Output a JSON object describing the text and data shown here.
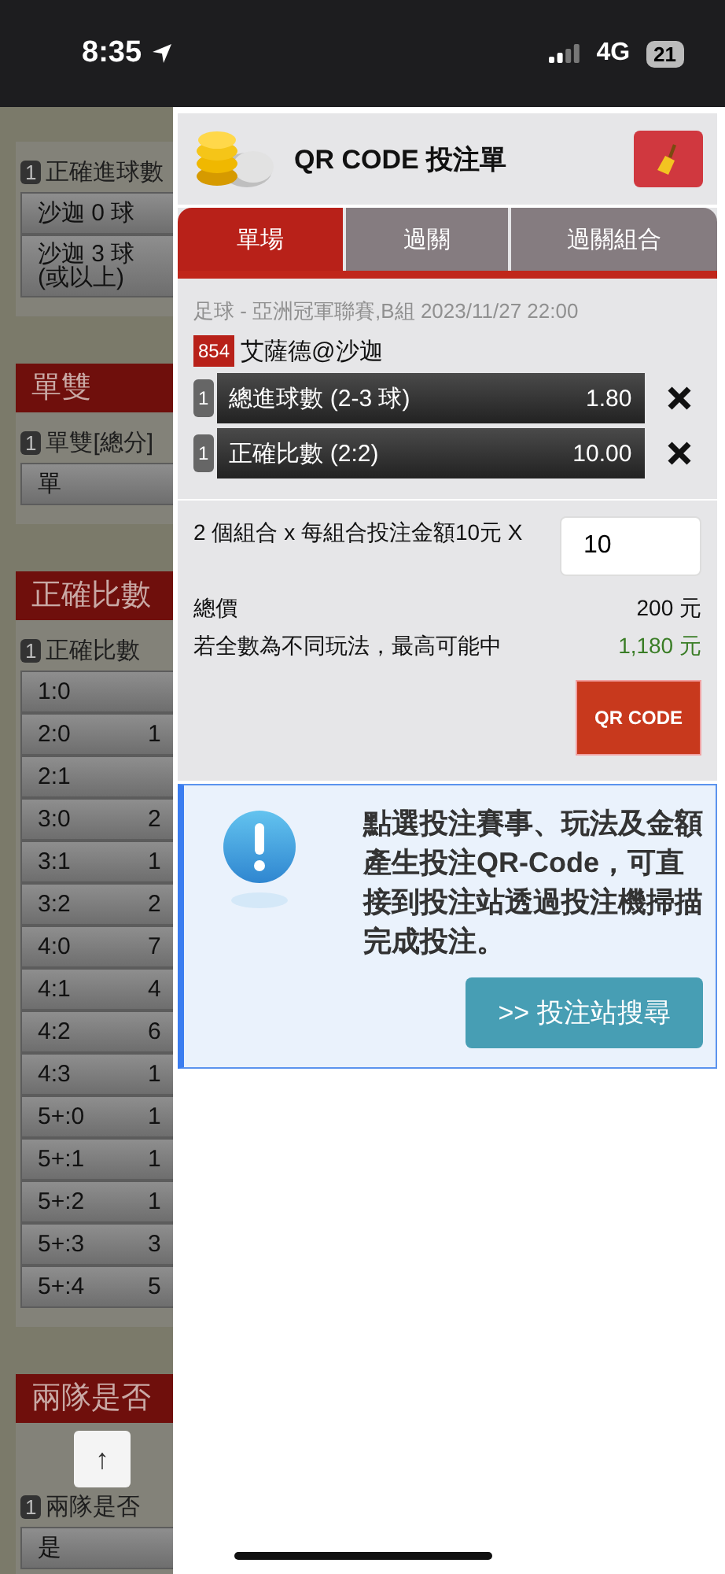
{
  "status_bar": {
    "time": "8:35",
    "network": "4G",
    "battery": "21"
  },
  "background": {
    "sections": [
      {
        "badge": "1",
        "label": "正確進球數",
        "rows": [
          {
            "name": "沙迦 0 球",
            "odds": ""
          },
          {
            "name": "沙迦 3 球\n(或以上)",
            "odds": ""
          }
        ]
      },
      {
        "header": "單雙",
        "badge": "1",
        "label": "單雙[總分]",
        "rows": [
          {
            "name": "單",
            "odds": ""
          }
        ]
      },
      {
        "header": "正確比數",
        "badge": "1",
        "label": "正確比數",
        "rows": [
          {
            "name": "1:0",
            "odds": ""
          },
          {
            "name": "2:0",
            "odds": "1"
          },
          {
            "name": "2:1",
            "odds": ""
          },
          {
            "name": "3:0",
            "odds": "2"
          },
          {
            "name": "3:1",
            "odds": "1"
          },
          {
            "name": "3:2",
            "odds": "2"
          },
          {
            "name": "4:0",
            "odds": "7"
          },
          {
            "name": "4:1",
            "odds": "4"
          },
          {
            "name": "4:2",
            "odds": "6"
          },
          {
            "name": "4:3",
            "odds": "1"
          },
          {
            "name": "5+:0",
            "odds": "1"
          },
          {
            "name": "5+:1",
            "odds": "1"
          },
          {
            "name": "5+:2",
            "odds": "1"
          },
          {
            "name": "5+:3",
            "odds": "3"
          },
          {
            "name": "5+:4",
            "odds": "5"
          }
        ]
      },
      {
        "header": "兩隊是否",
        "badge": "1",
        "label": "兩隊是否",
        "rows": [
          {
            "name": "是",
            "odds": ""
          }
        ]
      }
    ],
    "scroll_top_button": "↑"
  },
  "panel": {
    "title": "QR CODE 投注單",
    "tabs": [
      {
        "label": "單場",
        "selected": true
      },
      {
        "label": "過關",
        "selected": false
      },
      {
        "label": "過關組合",
        "selected": false
      }
    ],
    "event": {
      "info": "足球 - 亞洲冠軍聯賽,B組 2023/11/27 22:00",
      "match_no": "854",
      "match": "艾薩德@沙迦"
    },
    "bets": [
      {
        "badge": "1",
        "name": "總進球數 (2-3 球)",
        "odds": "1.80"
      },
      {
        "badge": "1",
        "name": "正確比數 (2:2)",
        "odds": "10.00"
      }
    ],
    "combo": {
      "text": "2 個組合 x 每組合投注金額10元 X",
      "value": "10"
    },
    "total": {
      "label": "總價",
      "value": "200 元"
    },
    "max_win": {
      "label": "若全數為不同玩法，最高可能中",
      "value": "1,180 元"
    },
    "qr_button": "QR CODE",
    "notice": {
      "text": "點選投注賽事、玩法及金額產生投注QR-Code，可直接到投注站透過投注機掃描完成投注。",
      "button": ">> 投注站搜尋"
    }
  }
}
